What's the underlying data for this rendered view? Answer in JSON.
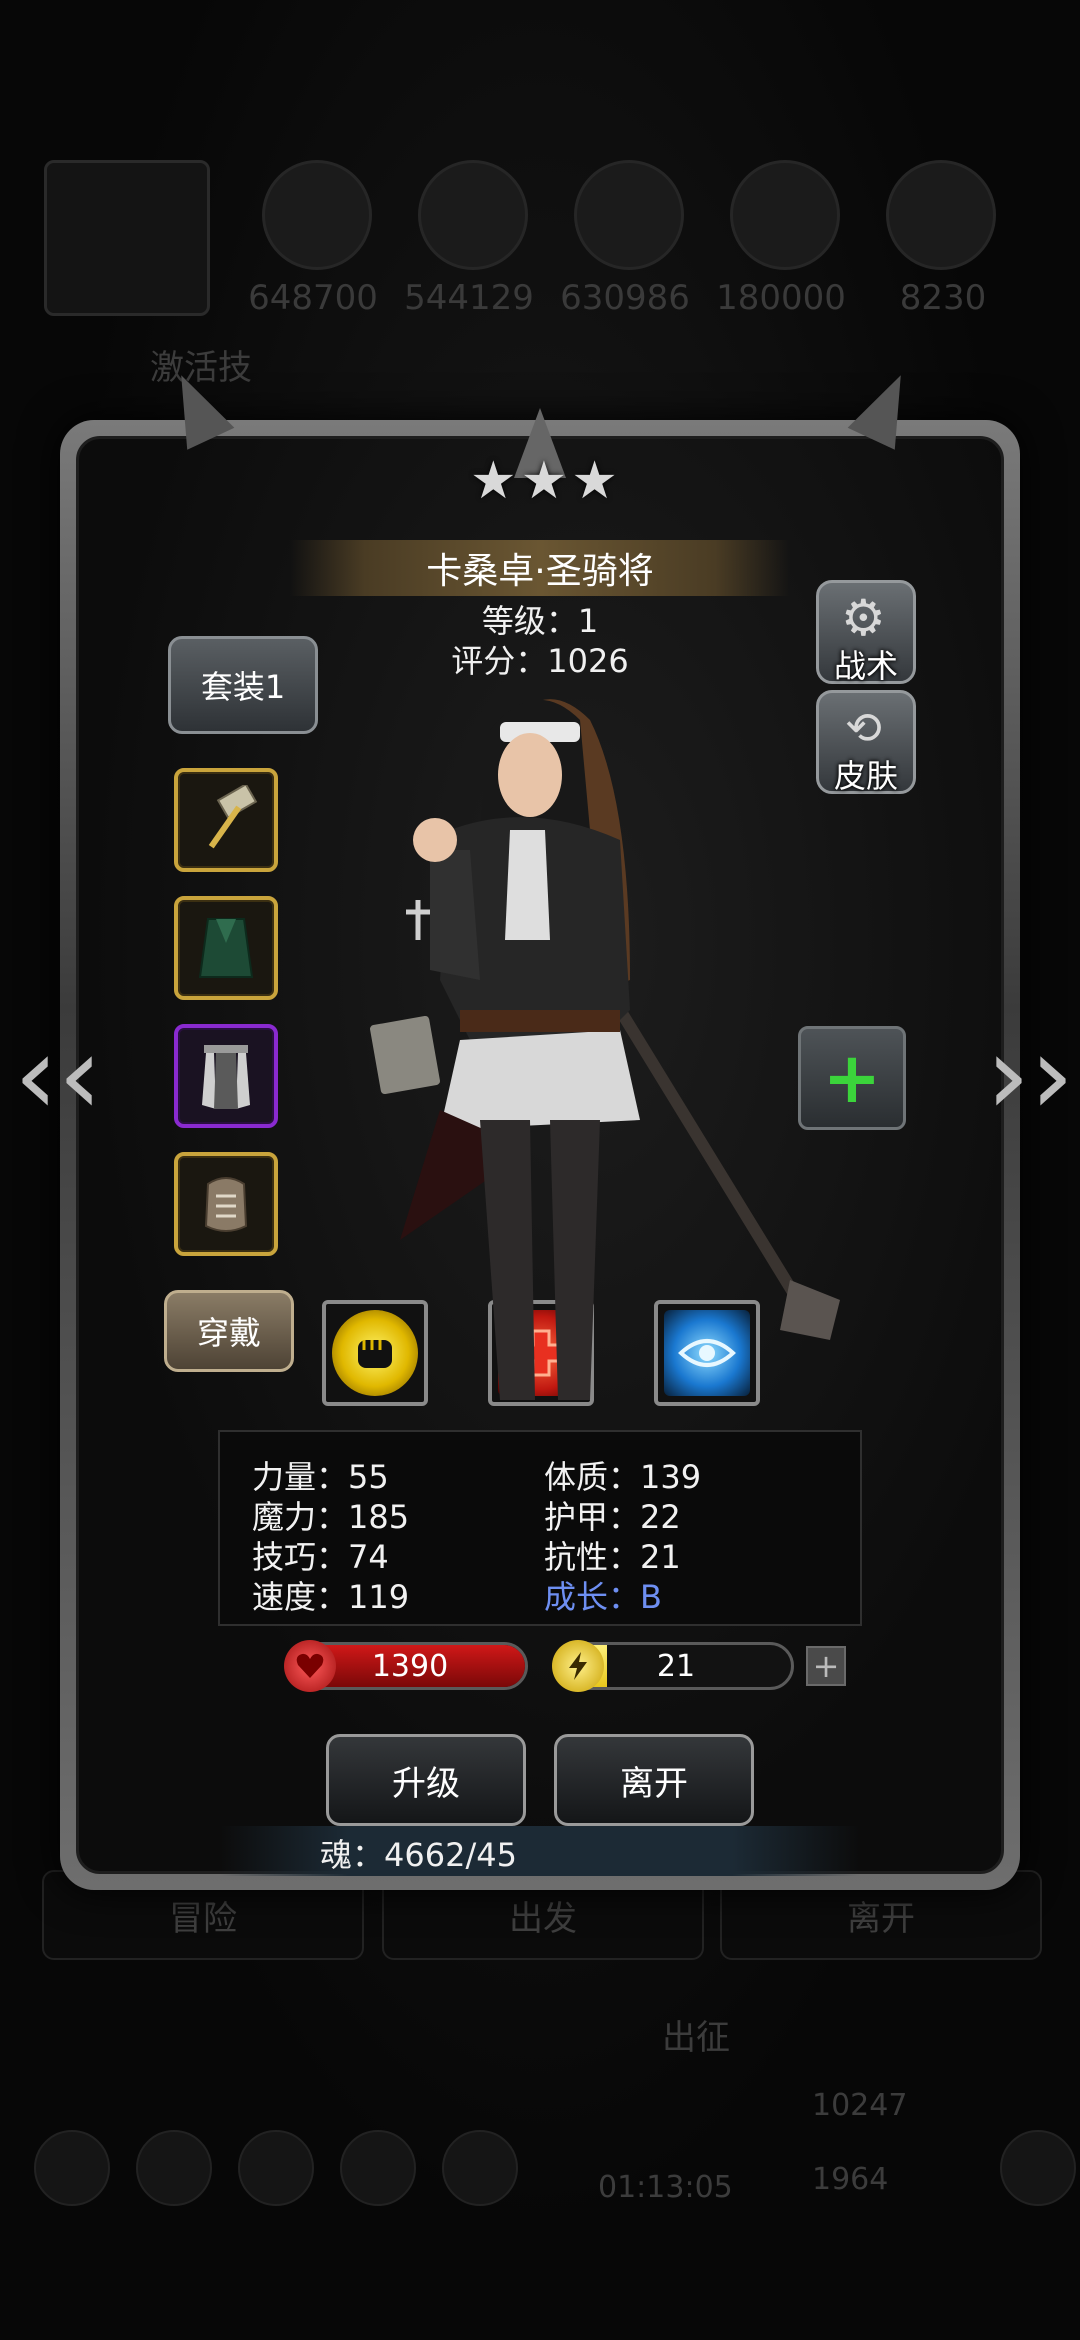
{
  "background": {
    "resources": [
      "648700",
      "544129",
      "630986",
      "180000",
      "8230"
    ],
    "banner_text": "激活技",
    "tabs": [
      "冒险",
      "出发",
      "离开"
    ],
    "sortie_label": "出征",
    "timer": "01:13:05",
    "counts": [
      "10247",
      "1964"
    ]
  },
  "hero": {
    "stars": 3,
    "name": "卡桑卓·圣骑将",
    "level": "等级：1",
    "score": "评分：1026"
  },
  "buttons": {
    "outfit": "套装1",
    "tactics": "战术",
    "skin": "皮肤",
    "equip": "穿戴",
    "upgrade": "升级",
    "leave": "离开"
  },
  "navigation": {
    "prev": "‹‹",
    "next": "››"
  },
  "equipment": [
    {
      "icon": "hammer-icon",
      "rarity": "gold"
    },
    {
      "icon": "cloak-icon",
      "rarity": "gold"
    },
    {
      "icon": "robe-icon",
      "rarity": "purple"
    },
    {
      "icon": "gauntlet-icon",
      "rarity": "gold"
    }
  ],
  "skills": [
    {
      "icon": "fist-icon",
      "color": "#f2d000"
    },
    {
      "icon": "heal-cross-icon",
      "color": "#e03020"
    },
    {
      "icon": "eye-icon",
      "color": "#2a8cf0"
    }
  ],
  "stats": {
    "strength": "力量：55",
    "magic": "魔力：185",
    "skill": "技巧：74",
    "speed": "速度：119",
    "constitution": "体质：139",
    "armor": "护甲：22",
    "resistance": "抗性：21",
    "growth": "成长：B"
  },
  "bars": {
    "hp": {
      "value": "1390",
      "fill": 1.0,
      "color": "#d01818"
    },
    "energy": {
      "value": "21",
      "fill": 0.2,
      "color": "#e8c81c"
    }
  },
  "soul": "魂：4662/45"
}
